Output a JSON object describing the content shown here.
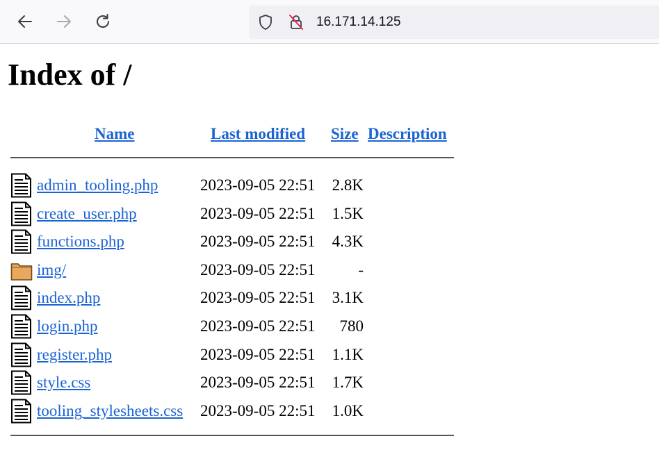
{
  "browser": {
    "url": "16.171.14.125"
  },
  "page": {
    "title": "Index of /",
    "columns": {
      "name": "Name",
      "last_modified": "Last modified",
      "size": "Size",
      "description": "Description"
    },
    "entries": [
      {
        "name": "admin_tooling.php",
        "modified": "2023-09-05 22:51",
        "size": "2.8K",
        "icon": "file-text-icon"
      },
      {
        "name": "create_user.php",
        "modified": "2023-09-05 22:51",
        "size": "1.5K",
        "icon": "file-text-icon"
      },
      {
        "name": "functions.php",
        "modified": "2023-09-05 22:51",
        "size": "4.3K",
        "icon": "file-text-icon"
      },
      {
        "name": "img/",
        "modified": "2023-09-05 22:51",
        "size": "-",
        "icon": "folder-icon"
      },
      {
        "name": "index.php",
        "modified": "2023-09-05 22:51",
        "size": "3.1K",
        "icon": "file-text-icon"
      },
      {
        "name": "login.php",
        "modified": "2023-09-05 22:51",
        "size": "780",
        "icon": "file-text-icon"
      },
      {
        "name": "register.php",
        "modified": "2023-09-05 22:51",
        "size": "1.1K",
        "icon": "file-text-icon"
      },
      {
        "name": "style.css",
        "modified": "2023-09-05 22:51",
        "size": "1.7K",
        "icon": "file-text-icon"
      },
      {
        "name": "tooling_stylesheets.css",
        "modified": "2023-09-05 22:51",
        "size": "1.0K",
        "icon": "file-text-icon"
      }
    ]
  },
  "colors": {
    "link": "#1a63d3",
    "folder": "#e8a95c"
  }
}
